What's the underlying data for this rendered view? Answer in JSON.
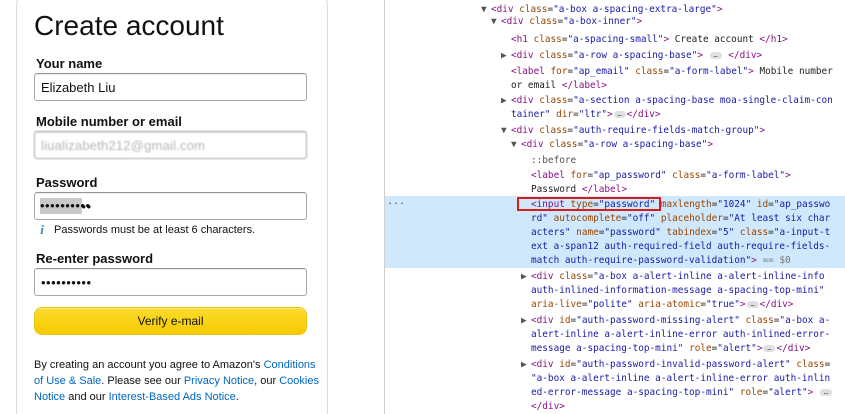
{
  "form": {
    "title": "Create account",
    "name_label": "Your name",
    "name_value": "Elizabeth Liu",
    "contact_label": "Mobile number or email",
    "contact_value": "liualizabeth212@gmail.com",
    "password_label": "Password",
    "password_value": "••••••••••",
    "password_hint": "Passwords must be at least 6 characters.",
    "reenter_label": "Re-enter password",
    "reenter_value": "••••••••••",
    "verify_button": "Verify e-mail",
    "legal_prefix": "By creating an account you agree to Amazon's ",
    "legal_link_conditions": "Conditions of Use & Sale",
    "legal_mid1": ". Please see our ",
    "legal_link_privacy": "Privacy Notice",
    "legal_mid2": ", our ",
    "legal_link_cookies": "Cookies Notice",
    "legal_mid3": " and our ",
    "legal_link_interest": "Interest-Based Ads Notice",
    "legal_suffix": "."
  },
  "devtools": {
    "gutter": "...",
    "ellipsis": "…",
    "lines": [
      {
        "indent": 94,
        "arrow": "▼",
        "html": "<span class=\"t\">&lt;div</span> <span class=\"an\">class</span>=\"<span class=\"av\">a-box a-spacing-extra-large</span>\"<span class=\"t\">&gt;</span>"
      },
      {
        "indent": 105,
        "arrow": "▼",
        "html": "<span class=\"t\">&lt;div</span> <span class=\"an\">class</span>=\"<span class=\"av\">a-box-inner</span>\"<span class=\"t\">&gt;</span>"
      },
      {
        "indent": 125,
        "arrow": "",
        "html": "<span class=\"t\">&lt;h1</span> <span class=\"an\">class</span>=\"<span class=\"av\">a-spacing-small</span>\"<span class=\"t\">&gt;</span><span class=\"tx\"> Create account </span><span class=\"t\">&lt;/h1&gt;</span>"
      }
    ]
  }
}
